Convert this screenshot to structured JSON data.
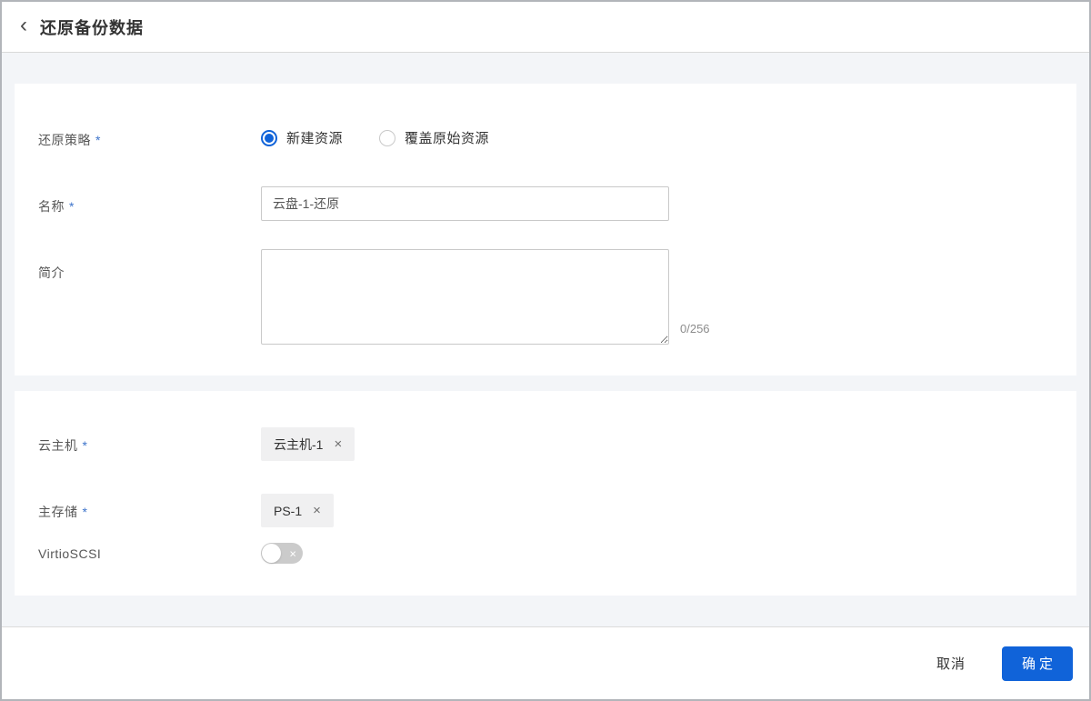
{
  "header": {
    "back_icon": "‹",
    "title": "还原备份数据"
  },
  "form": {
    "required_marker": "*",
    "restore_policy": {
      "label": "还原策略",
      "required": true,
      "options": [
        {
          "label": "新建资源",
          "selected": true
        },
        {
          "label": "覆盖原始资源",
          "selected": false
        }
      ]
    },
    "name": {
      "label": "名称",
      "required": true,
      "value": "云盘-1-还原"
    },
    "description": {
      "label": "简介",
      "value": "",
      "counter": "0/256"
    },
    "vm": {
      "label": "云主机",
      "required": true,
      "tag_text": "云主机-1",
      "remove_icon": "×"
    },
    "primary_storage": {
      "label": "主存储",
      "required": true,
      "tag_text": "PS-1",
      "remove_icon": "×"
    },
    "virtio_scsi": {
      "label": "VirtioSCSI",
      "state": "off",
      "off_icon": "×"
    }
  },
  "footer": {
    "cancel_label": "取消",
    "confirm_label": "确定"
  },
  "colors": {
    "accent_blue": "#1063d9",
    "required_marker": "#3d74cb",
    "body_background": "#f3f5f8",
    "toggle_off": "#cbcbcb",
    "tag_background": "#f0f0f1"
  }
}
